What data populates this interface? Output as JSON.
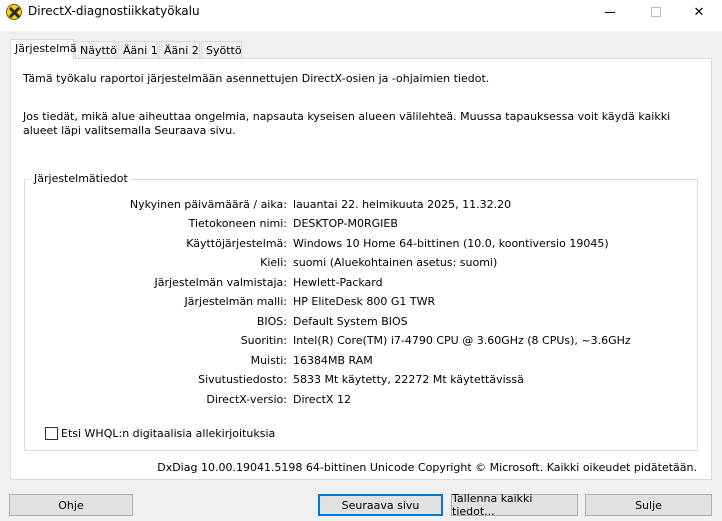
{
  "window": {
    "title": "DirectX-diagnostiikkatyökalu",
    "minimize": "—",
    "close": "✕"
  },
  "tabs": [
    "Järjestelmä",
    "Näyttö",
    "Ääni 1",
    "Ääni 2",
    "Syöttö"
  ],
  "active_tab": "Järjestelmä",
  "intro": {
    "line1": "Tämä työkalu raportoi järjestelmään asennettujen DirectX-osien ja -ohjaimien tiedot.",
    "line2": "Jos tiedät, mikä alue aiheuttaa ongelmia, napsauta kyseisen alueen välilehteä. Muussa tapauksessa voit käydä kaikki alueet läpi valitsemalla Seuraava sivu."
  },
  "system_info": {
    "group_title": "Järjestelmätiedot",
    "rows": [
      {
        "label": "Nykyinen päivämäärä / aika:",
        "value": "lauantai 22. helmikuuta 2025, 11.32.20"
      },
      {
        "label": "Tietokoneen nimi:",
        "value": "DESKTOP-M0RGIEB"
      },
      {
        "label": "Käyttöjärjestelmä:",
        "value": "Windows 10 Home 64-bittinen (10.0, koontiversio 19045)"
      },
      {
        "label": "Kieli:",
        "value": "suomi (Aluekohtainen asetus: suomi)"
      },
      {
        "label": "Järjestelmän valmistaja:",
        "value": "Hewlett-Packard"
      },
      {
        "label": "Järjestelmän malli:",
        "value": "HP EliteDesk 800 G1 TWR"
      },
      {
        "label": "BIOS:",
        "value": "Default System BIOS"
      },
      {
        "label": "Suoritin:",
        "value": "Intel(R) Core(TM) i7-4790 CPU @ 3.60GHz (8 CPUs), ~3.6GHz"
      },
      {
        "label": "Muisti:",
        "value": "16384MB RAM"
      },
      {
        "label": "Sivutustiedosto:",
        "value": "5833 Mt käytetty, 22272 Mt käytettävissä"
      },
      {
        "label": "DirectX-versio:",
        "value": "DirectX 12"
      }
    ]
  },
  "whql_checkbox": {
    "label": "Etsi WHQL:n digitaalisia allekirjoituksia",
    "checked": false
  },
  "footer": "DxDiag 10.00.19041.5198 64-bittinen Unicode  Copyright © Microsoft. Kaikki oikeudet pidätetään.",
  "buttons": {
    "help": "Ohje",
    "next": "Seuraava sivu",
    "save_all": "Tallenna kaikki tiedot...",
    "close": "Sulje"
  }
}
